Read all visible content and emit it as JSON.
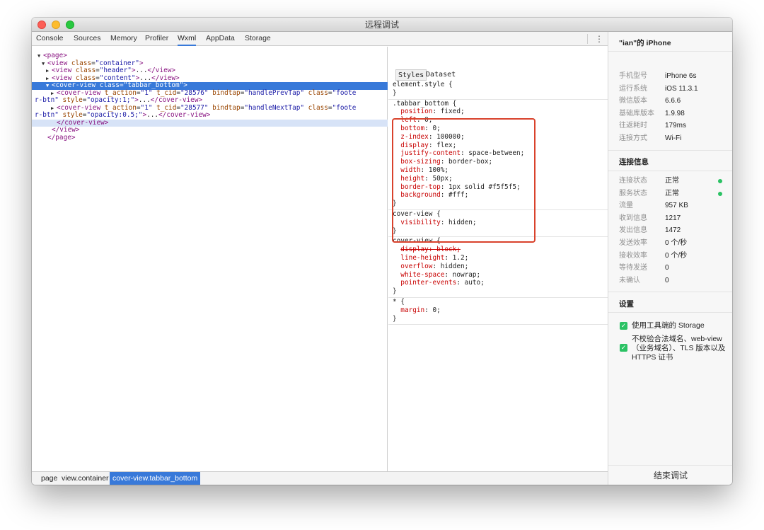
{
  "window": {
    "title": "远程调试"
  },
  "tabs": [
    "Console",
    "Sources",
    "Memory",
    "Profiler",
    "Wxml",
    "AppData",
    "Storage"
  ],
  "active_tab": "Wxml",
  "tree": [
    {
      "indent": 0,
      "arrow": "▼",
      "parts": [
        [
          "tag",
          "<page>"
        ]
      ]
    },
    {
      "indent": 1,
      "arrow": "▼",
      "parts": [
        [
          "tag",
          "<view "
        ],
        [
          "attr",
          "class"
        ],
        [
          "txt",
          "="
        ],
        [
          "val",
          "\"container\""
        ],
        [
          "tag",
          ">"
        ]
      ]
    },
    {
      "indent": 2,
      "arrow": "▶",
      "parts": [
        [
          "tag",
          "<view "
        ],
        [
          "attr",
          "class"
        ],
        [
          "txt",
          "="
        ],
        [
          "val",
          "\"header\""
        ],
        [
          "tag",
          ">"
        ],
        [
          "txt",
          "..."
        ],
        [
          "tag",
          "</view>"
        ]
      ]
    },
    {
      "indent": 2,
      "arrow": "▶",
      "parts": [
        [
          "tag",
          "<view "
        ],
        [
          "attr",
          "class"
        ],
        [
          "txt",
          "="
        ],
        [
          "val",
          "\"content\""
        ],
        [
          "tag",
          ">"
        ],
        [
          "txt",
          "..."
        ],
        [
          "tag",
          "</view>"
        ]
      ]
    },
    {
      "indent": 2,
      "arrow": "▼",
      "selected": true,
      "parts": [
        [
          "tag",
          "<cover-view "
        ],
        [
          "attr",
          "class"
        ],
        [
          "txt",
          "="
        ],
        [
          "val",
          "\"tabbar_bottom\""
        ],
        [
          "tag",
          ">"
        ]
      ]
    },
    {
      "indent": 3,
      "arrow": "▶",
      "parts": [
        [
          "tag",
          "<cover-view "
        ],
        [
          "attr",
          "t_action"
        ],
        [
          "txt",
          "="
        ],
        [
          "val",
          "\"1\" "
        ],
        [
          "attr",
          "t_cid"
        ],
        [
          "txt",
          "="
        ],
        [
          "val",
          "\"28576\" "
        ],
        [
          "attr",
          "bindtap"
        ],
        [
          "txt",
          "="
        ],
        [
          "val",
          "\"handlePrevTap\" "
        ],
        [
          "attr",
          "class"
        ],
        [
          "txt",
          "="
        ],
        [
          "val",
          "\"foote"
        ]
      ]
    },
    {
      "indent": 0,
      "arrow": "",
      "parts": [
        [
          "val",
          "r-btn\" "
        ],
        [
          "attr",
          "style"
        ],
        [
          "txt",
          "="
        ],
        [
          "val",
          "\"opacity:1;\""
        ],
        [
          "tag",
          ">"
        ],
        [
          "txt",
          "..."
        ],
        [
          "tag",
          "</cover-view>"
        ]
      ]
    },
    {
      "indent": 3,
      "arrow": "▶",
      "parts": [
        [
          "tag",
          "<cover-view "
        ],
        [
          "attr",
          "t_action"
        ],
        [
          "txt",
          "="
        ],
        [
          "val",
          "\"1\" "
        ],
        [
          "attr",
          "t_cid"
        ],
        [
          "txt",
          "="
        ],
        [
          "val",
          "\"28577\" "
        ],
        [
          "attr",
          "bindtap"
        ],
        [
          "txt",
          "="
        ],
        [
          "val",
          "\"handleNextTap\" "
        ],
        [
          "attr",
          "class"
        ],
        [
          "txt",
          "="
        ],
        [
          "val",
          "\"foote"
        ]
      ]
    },
    {
      "indent": 0,
      "arrow": "",
      "parts": [
        [
          "val",
          "r-btn\" "
        ],
        [
          "attr",
          "style"
        ],
        [
          "txt",
          "="
        ],
        [
          "val",
          "\"opacity:0.5;\""
        ],
        [
          "tag",
          ">"
        ],
        [
          "txt",
          "..."
        ],
        [
          "tag",
          "</cover-view>"
        ]
      ]
    },
    {
      "indent": 3,
      "arrow": "",
      "highlight": true,
      "parts": [
        [
          "tag",
          "</cover-view>"
        ]
      ]
    },
    {
      "indent": 2,
      "arrow": "",
      "parts": [
        [
          "tag",
          "</view>"
        ]
      ]
    },
    {
      "indent": 1,
      "arrow": "",
      "parts": [
        [
          "tag",
          "</page>"
        ]
      ]
    }
  ],
  "breadcrumb": [
    "page",
    "view.container",
    "cover-view.tabbar_bottom"
  ],
  "styles_tabs": [
    "Styles",
    "Dataset"
  ],
  "style_rules": [
    {
      "selector": "element.style {",
      "props": [],
      "close": "}"
    },
    {
      "selector": ".tabbar_bottom {",
      "props": [
        [
          "position",
          "fixed",
          false
        ],
        [
          "left",
          "0",
          false
        ],
        [
          "bottom",
          "0",
          false
        ],
        [
          "z-index",
          "100000",
          false
        ],
        [
          "display",
          "flex",
          false
        ],
        [
          "justify-content",
          "space-between",
          false
        ],
        [
          "box-sizing",
          "border-box",
          false
        ],
        [
          "width",
          "100%",
          false
        ],
        [
          "height",
          "50px",
          false
        ],
        [
          "border-top",
          "1px solid #f5f5f5",
          false
        ],
        [
          "background",
          "#fff",
          false
        ]
      ],
      "close": "}"
    },
    {
      "selector": "cover-view {",
      "props": [
        [
          "visibility",
          "hidden",
          false
        ]
      ],
      "close": "}"
    },
    {
      "selector": "cover-view {",
      "props": [
        [
          "display",
          "block",
          true
        ],
        [
          "line-height",
          "1.2",
          false
        ],
        [
          "overflow",
          "hidden",
          false
        ],
        [
          "white-space",
          "nowrap",
          false
        ],
        [
          "pointer-events",
          "auto",
          false
        ]
      ],
      "close": "}"
    },
    {
      "selector": "* {",
      "props": [
        [
          "margin",
          "0",
          false
        ]
      ],
      "close": "}"
    }
  ],
  "device": {
    "title": "\"ian\"的 iPhone",
    "items": [
      {
        "key": "手机型号",
        "value": "iPhone 6s"
      },
      {
        "key": "运行系统",
        "value": "iOS 11.3.1"
      },
      {
        "key": "微信版本",
        "value": "6.6.6"
      },
      {
        "key": "基础库版本",
        "value": "1.9.98"
      },
      {
        "key": "往返耗时",
        "value": "179ms"
      },
      {
        "key": "连接方式",
        "value": "Wi-Fi"
      }
    ]
  },
  "connection": {
    "title": "连接信息",
    "items": [
      {
        "key": "连接状态",
        "value": "正常",
        "dot": true
      },
      {
        "key": "服务状态",
        "value": "正常",
        "dot": true
      },
      {
        "key": "流量",
        "value": "957 KB"
      },
      {
        "key": "收到信息",
        "value": "1217"
      },
      {
        "key": "发出信息",
        "value": "1472"
      },
      {
        "key": "发送效率",
        "value": "0 个/秒"
      },
      {
        "key": "接收效率",
        "value": "0 个/秒"
      },
      {
        "key": "等待发送",
        "value": "0"
      },
      {
        "key": "未确认",
        "value": "0"
      }
    ]
  },
  "settings": {
    "title": "设置",
    "options": [
      {
        "label": "使用工具端的 Storage",
        "checked": true
      },
      {
        "label": "不校验合法域名、web-view（业务域名）、TLS 版本以及 HTTPS 证书",
        "checked": true
      }
    ]
  },
  "end_button": "结束调试",
  "colors": {
    "accent": "#3879d9",
    "highlight_box": "#d9422c",
    "status_ok": "#2bc264"
  }
}
